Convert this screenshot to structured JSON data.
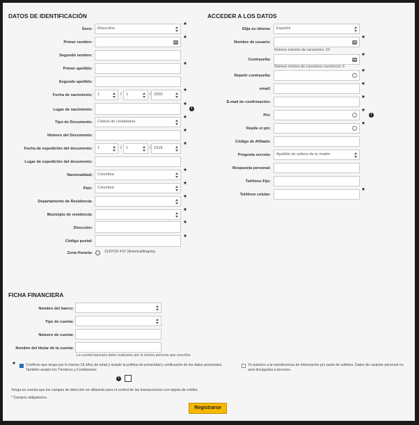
{
  "sections": {
    "identificacion": "DATOS DE IDENTIFICACIÓN",
    "acceder": "ACCEDER A LOS DATOS",
    "financiera": "FICHA FINANCIERA"
  },
  "ident": {
    "sexo_label": "Sexo:",
    "sexo_value": "Masculino",
    "primer_nombre_label": "Primer nombre:",
    "segundo_nombre_label": "Segundo nombre:",
    "primer_apellido_label": "Primer apellido:",
    "segundo_apellido_label": "Segundo apellido:",
    "fecha_nacimiento_label": "Fecha de nacimiento:",
    "fecha_nac_day": "1",
    "fecha_nac_month": "1",
    "fecha_nac_year": "2000",
    "lugar_nacimiento_label": "Lugar de nacimiento:",
    "tipo_documento_label": "Tipo de Documento:",
    "tipo_documento_value": "Cédula de ciudadanía",
    "numero_documento_label": "Número del Documento:",
    "fecha_expedicion_label": "Fecha de expedición del documento:",
    "fecha_exp_day": "1",
    "fecha_exp_month": "1",
    "fecha_exp_year": "1918",
    "lugar_expedicion_label": "Lugar de expedición del documento:",
    "nacionalidad_label": "Nacionalidad:",
    "nacionalidad_value": "Colombia",
    "pais_label": "País:",
    "pais_value": "Colombia",
    "departamento_label": "Departamento de Residencia:",
    "municipio_label": "Municipio de residencia:",
    "direccion_label": "Dirección:",
    "codigo_postal_label": "Código postal:",
    "zona_horaria_label": "Zona Horaria:",
    "zona_horaria_value": "11/07/18 4:57 (America/Bogota)",
    "slash": "/"
  },
  "acceso": {
    "idioma_label": "Elija su idioma:",
    "idioma_value": "Español",
    "usuario_label": "Nombre de usuario:",
    "usuario_hint": "Número máximo de caracteres: 20",
    "contrasena_label": "Contraseña:",
    "contrasena_hint": "Número mínimo de caracteres numéricos: 6",
    "repetir_contrasena_label": "Repetir contraseña:",
    "email_label": "email:",
    "email_confirm_label": "E-mail de confirmación:",
    "pin_label": "Pin:",
    "repite_pin_label": "Repite el pin:",
    "afiliado_label": "Código de Afiliado:",
    "pregunta_label": "Pregunta secreta:",
    "pregunta_value": "Apellido de soltera de tu madre",
    "respuesta_label": "Respuesta personal:",
    "telefono_fijo_label": "Teléfono Fijo:",
    "telefono_celular_label": "Teléfono celular:"
  },
  "financiera": {
    "banco_label": "Nombre del banco:",
    "tipo_cuenta_label": "Tipo de cuenta:",
    "numero_cuenta_label": "Número de cuenta:",
    "titular_label": "Nombre del titular de la cuenta:",
    "titular_hint": "La cuenta bancaria debe realizarse por la misma persona que suscriba"
  },
  "consent": {
    "terms_text": "Confirmo que tengo por lo menos 18 años de edad y acepto la política de privacidad y verificación de los datos personales. También acepto los Términos y Condiciones",
    "terms_checked": true,
    "transfer_text": "Yo autorizo a la transferencia de información por parte de usfeltes. Datos de carácter personal no será divulgados a terceros.",
    "transfer_checked": false
  },
  "footer": {
    "note": "Tenga en cuenta que los campos de dirección se utilizarán para el control de las transacciones con tarjeta de crédito.",
    "required_note": "* Campos obligatorios.",
    "register_label": "Registrarse"
  },
  "required_mark": "*",
  "info_glyph": "i"
}
